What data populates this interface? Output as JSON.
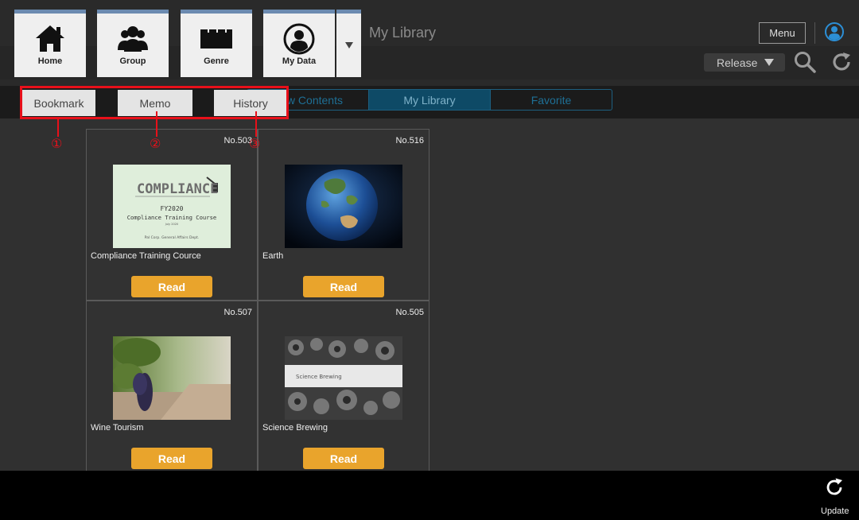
{
  "nav": {
    "items": [
      {
        "label": "Home",
        "icon": "home-icon"
      },
      {
        "label": "Group",
        "icon": "group-icon"
      },
      {
        "label": "Genre",
        "icon": "genre-icon"
      },
      {
        "label": "My Data",
        "icon": "user-data-icon"
      }
    ]
  },
  "header": {
    "title": "My Library",
    "menu_label": "Menu",
    "sort_select": "Release"
  },
  "segments": [
    "New Contents",
    "My Library",
    "Favorite"
  ],
  "subtabs": [
    "Bookmark",
    "Memo",
    "History"
  ],
  "callouts": [
    "①",
    "②",
    "③"
  ],
  "cards": [
    {
      "no": "No.503",
      "title": "Compliance Training Cource",
      "read": "Read",
      "thumb": {
        "heading": "COMPLIANCE",
        "line1": "FY2020",
        "line2": "Compliance Training Course",
        "line3": "July 2020",
        "footer": "Pal Corp. General Affairs Dept."
      }
    },
    {
      "no": "No.516",
      "title": "Earth",
      "read": "Read"
    },
    {
      "no": "No.507",
      "title": "Wine Tourism",
      "read": "Read"
    },
    {
      "no": "No.505",
      "title": "Science Brewing",
      "read": "Read",
      "thumb": {
        "banner": "Science Brewing"
      }
    }
  ],
  "footer": {
    "update_label": "Update"
  },
  "colors": {
    "accent": "#e9a42c",
    "highlight": "#e8101a",
    "segment_active": "#0e4a66"
  }
}
